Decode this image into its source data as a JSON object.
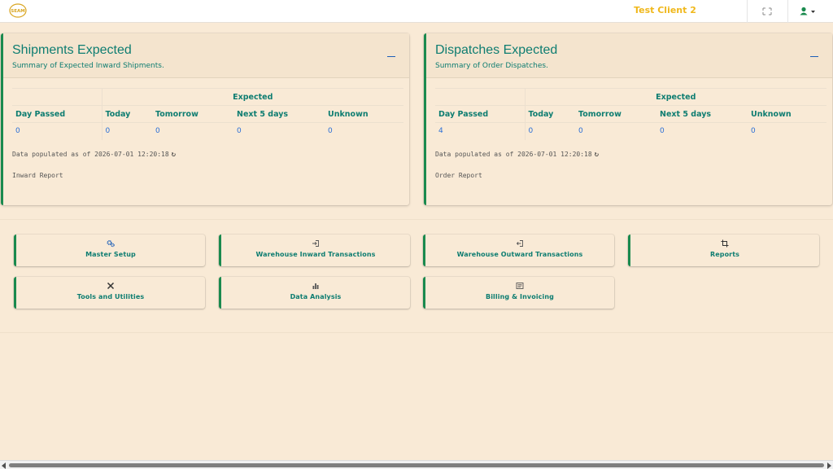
{
  "header": {
    "logo_text": "SEAM",
    "client_name": "Test Client 2",
    "fullscreen_icon": "expand-icon",
    "user_icon": "user-icon"
  },
  "colors": {
    "accent": "#0e7d71",
    "border_accent": "#1a8a4e",
    "client": "#f0b81c",
    "value": "#2a6ed6",
    "background": "#f9ead6"
  },
  "shipments": {
    "title": "Shipments Expected",
    "subtitle": "Summary of Expected Inward Shipments.",
    "group_header": "Expected",
    "columns": [
      "Day Passed",
      "Today",
      "Tomorrow",
      "Next 5 days",
      "Unknown"
    ],
    "values": [
      "0",
      "0",
      "0",
      "0",
      "0"
    ],
    "populated_text": "Data populated as of 2026-07-01 12:20:18",
    "report_link": "Inward Report"
  },
  "dispatches": {
    "title": "Dispatches Expected",
    "subtitle": "Summary of Order Dispatches.",
    "group_header": "Expected",
    "columns": [
      "Day Passed",
      "Today",
      "Tomorrow",
      "Next 5 days",
      "Unknown"
    ],
    "values": [
      "4",
      "0",
      "0",
      "0",
      "0"
    ],
    "populated_text": "Data populated as of 2026-07-01 12:20:18",
    "report_link": "Order Report"
  },
  "modules": [
    {
      "label": "Master Setup",
      "icon": "cogs-icon"
    },
    {
      "label": "Warehouse Inward Transactions",
      "icon": "sign-in-icon"
    },
    {
      "label": "Warehouse Outward Transactions",
      "icon": "sign-out-icon"
    },
    {
      "label": "Reports",
      "icon": "crop-icon"
    },
    {
      "label": "Tools and Utilities",
      "icon": "tools-icon"
    },
    {
      "label": "Data Analysis",
      "icon": "bar-chart-icon"
    },
    {
      "label": "Billing & Invoicing",
      "icon": "invoice-icon"
    }
  ]
}
